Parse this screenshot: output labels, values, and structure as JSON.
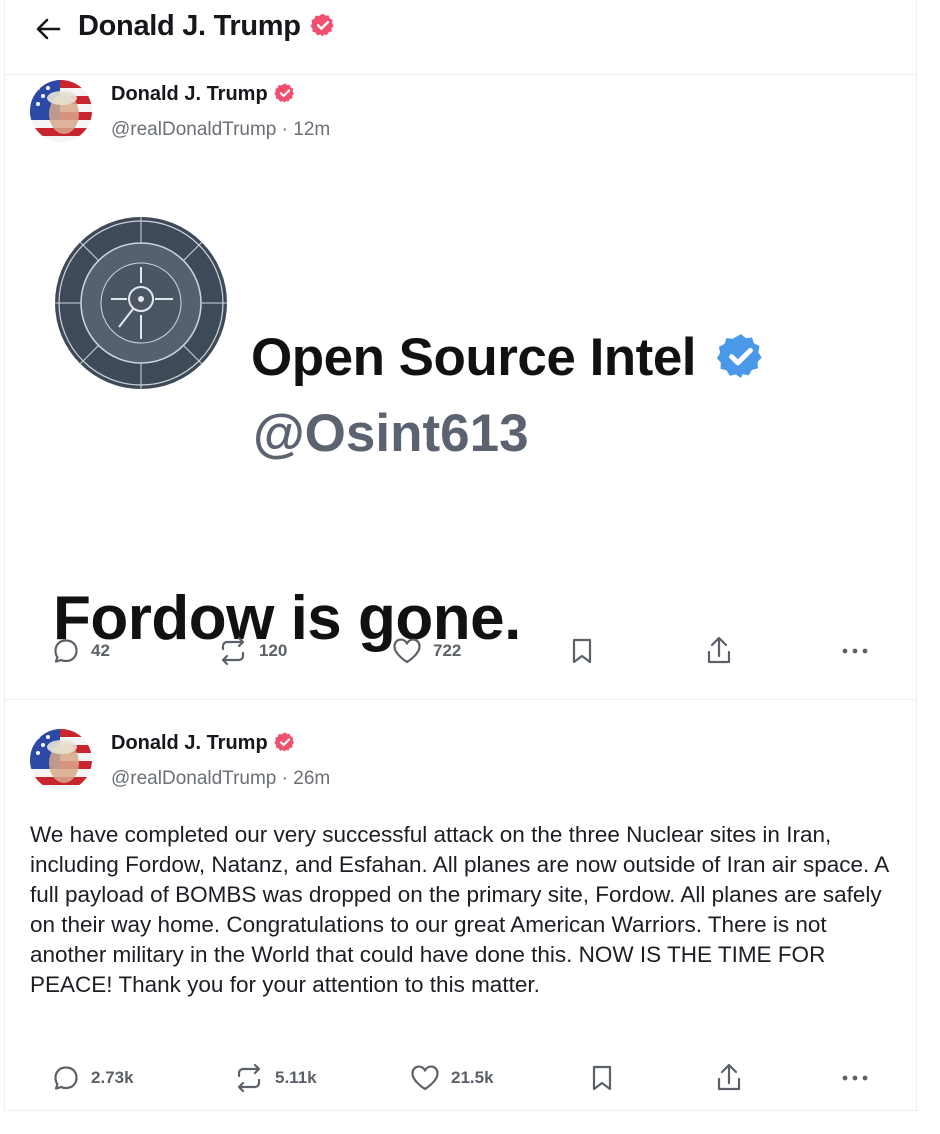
{
  "header": {
    "title": "Donald J. Trump"
  },
  "posts": [
    {
      "author": "Donald J. Trump",
      "handle": "@realDonaldTrump",
      "time": "12m",
      "embed": {
        "account_name": "Open Source Intel",
        "account_handle": "@Osint613",
        "text": "Fordow is gone."
      },
      "stats": {
        "replies": "42",
        "reposts": "120",
        "likes": "722"
      }
    },
    {
      "author": "Donald J. Trump",
      "handle": "@realDonaldTrump",
      "time": "26m",
      "text": "We have completed our very successful attack on the three Nuclear sites in Iran, including Fordow, Natanz, and Esfahan. All planes are now outside of Iran air space. A full payload of BOMBS was dropped on the primary site, Fordow. All planes are safely on their way home. Congratulations to our great American Warriors. There is not another military in the World that could have done this. NOW IS THE TIME FOR PEACE! Thank you for your attention to this matter.",
      "stats": {
        "replies": "2.73k",
        "reposts": "5.11k",
        "likes": "21.5k"
      }
    }
  ],
  "icons": {
    "back": "arrow-left-icon",
    "verified_author": "verified-badge-icon",
    "verified_embed": "blue-check-icon",
    "reply": "comment-icon",
    "repost": "repost-icon",
    "like": "heart-icon",
    "bookmark": "bookmark-icon",
    "share": "share-icon",
    "more": "ellipsis-icon"
  },
  "colors": {
    "verified_badge": "#f0506e",
    "embed_check": "#4a99e9",
    "muted_text": "#6a6f78",
    "divider": "#eceef1"
  }
}
